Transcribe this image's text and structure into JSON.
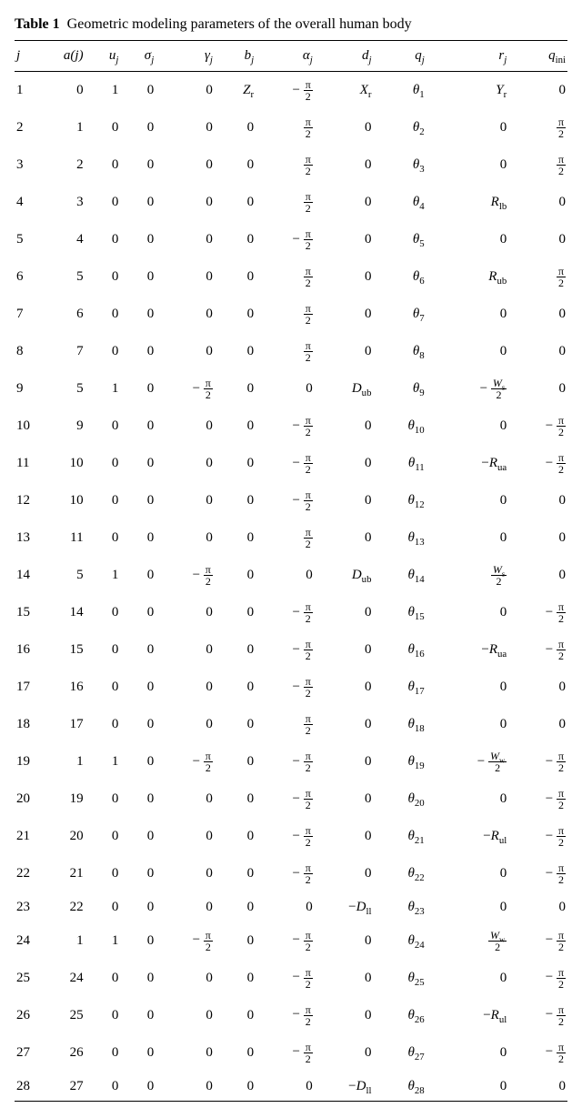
{
  "caption_label": "Table 1",
  "caption_text": "Geometric modeling parameters of the overall human body",
  "headers": {
    "j": "j",
    "aj": "a(j)",
    "uj_var": "u",
    "uj_sub": "j",
    "sigj_var": "σ",
    "sigj_sub": "j",
    "gamj_var": "γ",
    "gamj_sub": "j",
    "bj_var": "b",
    "bj_sub": "j",
    "alpj_var": "α",
    "alpj_sub": "j",
    "dj_var": "d",
    "dj_sub": "j",
    "qj_var": "q",
    "qj_sub": "j",
    "rj_var": "r",
    "rj_sub": "j",
    "qini_var": "q",
    "qini_sub": "ini"
  },
  "chart_data": {
    "type": "table",
    "title": "Geometric modeling parameters of the overall human body",
    "columns": [
      "j",
      "a(j)",
      "u_j",
      "σ_j",
      "γ_j",
      "b_j",
      "α_j",
      "d_j",
      "q_j",
      "r_j",
      "q_ini"
    ],
    "symbols": {
      "pi2": "π/2",
      "npi2": "-π/2",
      "Zr": "Z_r",
      "Xr": "X_r",
      "Yr": "Y_r",
      "Rlb": "R_lb",
      "Rub": "R_ub",
      "Rua": "R_ua",
      "Rul": "R_ul",
      "Dub": "D_ub",
      "Dll": "D_ll",
      "Ws2": "W_s/2",
      "Ww2": "W_w/2",
      "nWs2": "-W_s/2",
      "nRua": "-R_ua",
      "nRul": "-R_ul",
      "nWw2": "-W_w/2",
      "nDll": "-D_ll"
    },
    "rows": [
      {
        "j": 1,
        "aj": 0,
        "uj": 1,
        "sigj": 0,
        "gamj": "0",
        "bj": "Zr",
        "alpj": "npi2",
        "dj": "Xr",
        "qj": "θ_1",
        "rj": "Yr",
        "qini": "0"
      },
      {
        "j": 2,
        "aj": 1,
        "uj": 0,
        "sigj": 0,
        "gamj": "0",
        "bj": "0",
        "alpj": "pi2",
        "dj": "0",
        "qj": "θ_2",
        "rj": "0",
        "qini": "pi2"
      },
      {
        "j": 3,
        "aj": 2,
        "uj": 0,
        "sigj": 0,
        "gamj": "0",
        "bj": "0",
        "alpj": "pi2",
        "dj": "0",
        "qj": "θ_3",
        "rj": "0",
        "qini": "pi2"
      },
      {
        "j": 4,
        "aj": 3,
        "uj": 0,
        "sigj": 0,
        "gamj": "0",
        "bj": "0",
        "alpj": "pi2",
        "dj": "0",
        "qj": "θ_4",
        "rj": "Rlb",
        "qini": "0"
      },
      {
        "j": 5,
        "aj": 4,
        "uj": 0,
        "sigj": 0,
        "gamj": "0",
        "bj": "0",
        "alpj": "npi2",
        "dj": "0",
        "qj": "θ_5",
        "rj": "0",
        "qini": "0"
      },
      {
        "j": 6,
        "aj": 5,
        "uj": 0,
        "sigj": 0,
        "gamj": "0",
        "bj": "0",
        "alpj": "pi2",
        "dj": "0",
        "qj": "θ_6",
        "rj": "Rub",
        "qini": "pi2"
      },
      {
        "j": 7,
        "aj": 6,
        "uj": 0,
        "sigj": 0,
        "gamj": "0",
        "bj": "0",
        "alpj": "pi2",
        "dj": "0",
        "qj": "θ_7",
        "rj": "0",
        "qini": "0"
      },
      {
        "j": 8,
        "aj": 7,
        "uj": 0,
        "sigj": 0,
        "gamj": "0",
        "bj": "0",
        "alpj": "pi2",
        "dj": "0",
        "qj": "θ_8",
        "rj": "0",
        "qini": "0"
      },
      {
        "j": 9,
        "aj": 5,
        "uj": 1,
        "sigj": 0,
        "gamj": "npi2",
        "bj": "0",
        "alpj": "0",
        "dj": "Dub",
        "qj": "θ_9",
        "rj": "nWs2",
        "qini": "0"
      },
      {
        "j": 10,
        "aj": 9,
        "uj": 0,
        "sigj": 0,
        "gamj": "0",
        "bj": "0",
        "alpj": "npi2",
        "dj": "0",
        "qj": "θ_10",
        "rj": "0",
        "qini": "npi2"
      },
      {
        "j": 11,
        "aj": 10,
        "uj": 0,
        "sigj": 0,
        "gamj": "0",
        "bj": "0",
        "alpj": "npi2",
        "dj": "0",
        "qj": "θ_11",
        "rj": "nRua",
        "qini": "npi2"
      },
      {
        "j": 12,
        "aj": 10,
        "uj": 0,
        "sigj": 0,
        "gamj": "0",
        "bj": "0",
        "alpj": "npi2",
        "dj": "0",
        "qj": "θ_12",
        "rj": "0",
        "qini": "0"
      },
      {
        "j": 13,
        "aj": 11,
        "uj": 0,
        "sigj": 0,
        "gamj": "0",
        "bj": "0",
        "alpj": "pi2",
        "dj": "0",
        "qj": "θ_13",
        "rj": "0",
        "qini": "0"
      },
      {
        "j": 14,
        "aj": 5,
        "uj": 1,
        "sigj": 0,
        "gamj": "npi2",
        "bj": "0",
        "alpj": "0",
        "dj": "Dub",
        "qj": "θ_14",
        "rj": "Ws2",
        "qini": "0"
      },
      {
        "j": 15,
        "aj": 14,
        "uj": 0,
        "sigj": 0,
        "gamj": "0",
        "bj": "0",
        "alpj": "npi2",
        "dj": "0",
        "qj": "θ_15",
        "rj": "0",
        "qini": "npi2"
      },
      {
        "j": 16,
        "aj": 15,
        "uj": 0,
        "sigj": 0,
        "gamj": "0",
        "bj": "0",
        "alpj": "npi2",
        "dj": "0",
        "qj": "θ_16",
        "rj": "nRua",
        "qini": "npi2"
      },
      {
        "j": 17,
        "aj": 16,
        "uj": 0,
        "sigj": 0,
        "gamj": "0",
        "bj": "0",
        "alpj": "npi2",
        "dj": "0",
        "qj": "θ_17",
        "rj": "0",
        "qini": "0"
      },
      {
        "j": 18,
        "aj": 17,
        "uj": 0,
        "sigj": 0,
        "gamj": "0",
        "bj": "0",
        "alpj": "pi2",
        "dj": "0",
        "qj": "θ_18",
        "rj": "0",
        "qini": "0"
      },
      {
        "j": 19,
        "aj": 1,
        "uj": 1,
        "sigj": 0,
        "gamj": "npi2",
        "bj": "0",
        "alpj": "npi2",
        "dj": "0",
        "qj": "θ_19",
        "rj": "nWw2",
        "qini": "npi2"
      },
      {
        "j": 20,
        "aj": 19,
        "uj": 0,
        "sigj": 0,
        "gamj": "0",
        "bj": "0",
        "alpj": "npi2",
        "dj": "0",
        "qj": "θ_20",
        "rj": "0",
        "qini": "npi2"
      },
      {
        "j": 21,
        "aj": 20,
        "uj": 0,
        "sigj": 0,
        "gamj": "0",
        "bj": "0",
        "alpj": "npi2",
        "dj": "0",
        "qj": "θ_21",
        "rj": "nRul",
        "qini": "npi2"
      },
      {
        "j": 22,
        "aj": 21,
        "uj": 0,
        "sigj": 0,
        "gamj": "0",
        "bj": "0",
        "alpj": "npi2",
        "dj": "0",
        "qj": "θ_22",
        "rj": "0",
        "qini": "npi2"
      },
      {
        "j": 23,
        "aj": 22,
        "uj": 0,
        "sigj": 0,
        "gamj": "0",
        "bj": "0",
        "alpj": "0",
        "dj": "nDll",
        "qj": "θ_23",
        "rj": "0",
        "qini": "0"
      },
      {
        "j": 24,
        "aj": 1,
        "uj": 1,
        "sigj": 0,
        "gamj": "npi2",
        "bj": "0",
        "alpj": "npi2",
        "dj": "0",
        "qj": "θ_24",
        "rj": "Ww2",
        "qini": "npi2"
      },
      {
        "j": 25,
        "aj": 24,
        "uj": 0,
        "sigj": 0,
        "gamj": "0",
        "bj": "0",
        "alpj": "npi2",
        "dj": "0",
        "qj": "θ_25",
        "rj": "0",
        "qini": "npi2"
      },
      {
        "j": 26,
        "aj": 25,
        "uj": 0,
        "sigj": 0,
        "gamj": "0",
        "bj": "0",
        "alpj": "npi2",
        "dj": "0",
        "qj": "θ_26",
        "rj": "nRul",
        "qini": "npi2"
      },
      {
        "j": 27,
        "aj": 26,
        "uj": 0,
        "sigj": 0,
        "gamj": "0",
        "bj": "0",
        "alpj": "npi2",
        "dj": "0",
        "qj": "θ_27",
        "rj": "0",
        "qini": "npi2"
      },
      {
        "j": 28,
        "aj": 27,
        "uj": 0,
        "sigj": 0,
        "gamj": "0",
        "bj": "0",
        "alpj": "0",
        "dj": "nDll",
        "qj": "θ_28",
        "rj": "0",
        "qini": "0"
      }
    ]
  }
}
